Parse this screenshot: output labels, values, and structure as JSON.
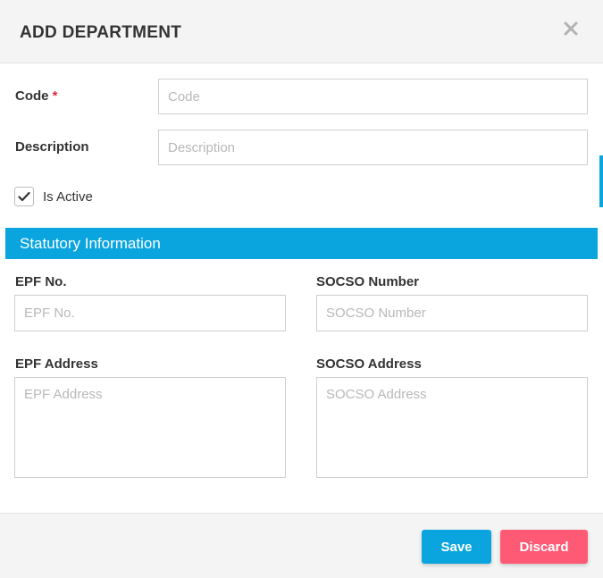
{
  "dialog": {
    "title": "ADD DEPARTMENT",
    "close_icon": "close-icon"
  },
  "form": {
    "code": {
      "label": "Code",
      "required_mark": "*",
      "placeholder": "Code",
      "value": ""
    },
    "description": {
      "label": "Description",
      "placeholder": "Description",
      "value": ""
    },
    "is_active": {
      "label": "Is Active",
      "checked": true
    }
  },
  "statutory": {
    "section_title": "Statutory Information",
    "epf_no": {
      "label": "EPF No.",
      "placeholder": "EPF No."
    },
    "socso_number": {
      "label": "SOCSO Number",
      "placeholder": "SOCSO Number"
    },
    "epf_address": {
      "label": "EPF Address",
      "placeholder": "EPF Address"
    },
    "socso_address": {
      "label": "SOCSO Address",
      "placeholder": "SOCSO Address"
    }
  },
  "footer": {
    "save_label": "Save",
    "discard_label": "Discard"
  },
  "colors": {
    "accent": "#0aa5de",
    "discard": "#ff5a75",
    "required": "#e0293c"
  }
}
